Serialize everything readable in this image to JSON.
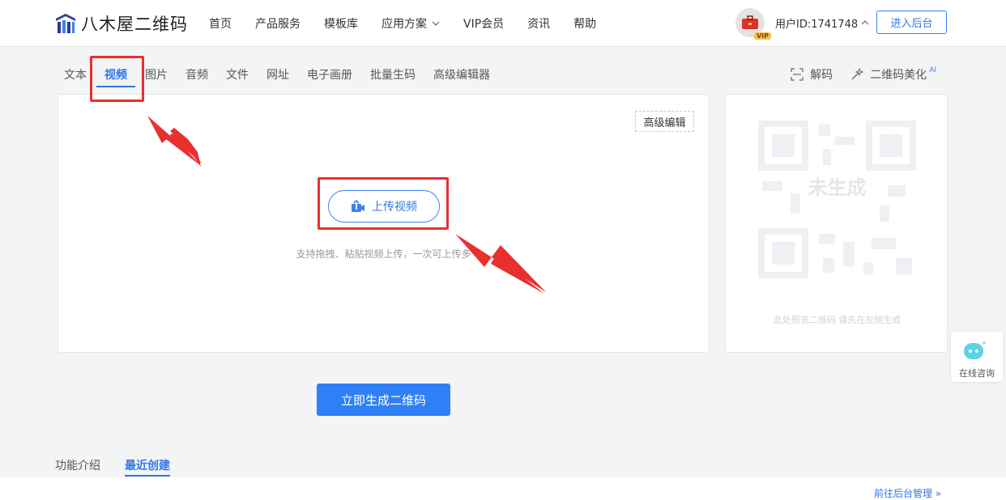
{
  "header": {
    "logo_text": "八木屋二维码",
    "nav": [
      {
        "label": "首页"
      },
      {
        "label": "产品服务"
      },
      {
        "label": "模板库"
      },
      {
        "label": "应用方案",
        "has_dropdown": true
      },
      {
        "label": "VIP会员"
      },
      {
        "label": "资讯"
      },
      {
        "label": "帮助"
      }
    ],
    "user_id": "用户ID:1741748",
    "vip_badge": "VIP",
    "enter_button": "进入后台"
  },
  "tabs": [
    {
      "label": "文本"
    },
    {
      "label": "视频",
      "active": true
    },
    {
      "label": "图片"
    },
    {
      "label": "音频"
    },
    {
      "label": "文件"
    },
    {
      "label": "网址"
    },
    {
      "label": "电子画册"
    },
    {
      "label": "批量生码"
    },
    {
      "label": "高级编辑器"
    }
  ],
  "tools": {
    "decode": "解码",
    "beautify": "二维码美化",
    "beautify_badge": "AI"
  },
  "editor": {
    "advanced_edit": "高级编辑",
    "upload_button": "上传视频",
    "hint": "支持拖拽、粘贴视频上传，一次可上传多"
  },
  "preview": {
    "placeholder_label": "未生成",
    "tip": "此处预览二维码 请先在左侧生成"
  },
  "float": {
    "consult": "在线咨询"
  },
  "generate_button": "立即生成二维码",
  "bottom_tabs": [
    {
      "label": "功能介绍"
    },
    {
      "label": "最近创建",
      "active": true
    }
  ],
  "manage_link": "前往后台管理 »",
  "colors": {
    "accent": "#2f77e6",
    "primary_button": "#2f80f6",
    "highlight_red": "#e8302f"
  }
}
